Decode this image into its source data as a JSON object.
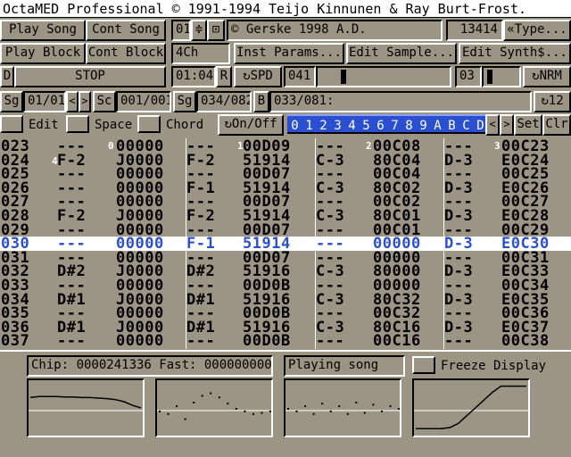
{
  "title": "OctaMED Professional © 1991-1994 Teijo Kinnunen & Ray Burt-Frost.",
  "transport": {
    "play_song": "Play Song",
    "cont_song": "Cont Song",
    "play_block": "Play Block",
    "cont_block": "Cont Block",
    "d": "D",
    "stop": "STOP"
  },
  "song": {
    "num": "01",
    "name": "Gerske 1998 A.D.",
    "memory": "13414",
    "type_button": "«Type...",
    "channels": "4Ch",
    "time": "01:04",
    "r": "R",
    "spd_label": "SPD",
    "spd_value": "041",
    "sample_num": "03",
    "nrm": "NRM"
  },
  "edit_buttons": {
    "inst_params": "Inst Params...",
    "edit_sample": "Edit Sample...",
    "edit_synth": "Edit Synth$..."
  },
  "position": {
    "sg": "Sg",
    "sg_val": "01/01",
    "left": "<",
    "right": ">",
    "sc": "Sc",
    "sc_val": "001/001",
    "sg2": "Sg",
    "sg2_val": "034/082",
    "b": "B",
    "block_val": "033/081:",
    "num12": "12"
  },
  "options": {
    "edit": "Edit",
    "space": "Space",
    "chord": "Chord",
    "on_off": "On/Off",
    "set": "Set",
    "clr": "Clr",
    "left": "<",
    "right": ">"
  },
  "tracks": [
    "0",
    "1",
    "2",
    "3",
    "4",
    "5",
    "6",
    "7",
    "8",
    "9",
    "A",
    "B",
    "C",
    "D"
  ],
  "track_markers": [
    "4",
    "0",
    "1",
    "2",
    "3"
  ],
  "pattern": {
    "current_index": 7,
    "rows": [
      {
        "n": "023",
        "c": [
          [
            "---",
            "00000"
          ],
          [
            "---",
            "00D09"
          ],
          [
            "---",
            "00C08"
          ],
          [
            "---",
            "00C23"
          ]
        ]
      },
      {
        "n": "024",
        "c": [
          [
            "F-2",
            "J0000"
          ],
          [
            "F-2",
            "51914"
          ],
          [
            "C-3",
            "80C04"
          ],
          [
            "D-3",
            "E0C24"
          ]
        ]
      },
      {
        "n": "025",
        "c": [
          [
            "---",
            "00000"
          ],
          [
            "---",
            "00D07"
          ],
          [
            "---",
            "00C04"
          ],
          [
            "---",
            "00C25"
          ]
        ]
      },
      {
        "n": "026",
        "c": [
          [
            "---",
            "00000"
          ],
          [
            "F-1",
            "51914"
          ],
          [
            "C-3",
            "80C02"
          ],
          [
            "D-3",
            "E0C26"
          ]
        ]
      },
      {
        "n": "027",
        "c": [
          [
            "---",
            "00000"
          ],
          [
            "---",
            "00D07"
          ],
          [
            "---",
            "00C02"
          ],
          [
            "---",
            "00C27"
          ]
        ]
      },
      {
        "n": "028",
        "c": [
          [
            "F-2",
            "J0000"
          ],
          [
            "F-2",
            "51914"
          ],
          [
            "C-3",
            "80C01"
          ],
          [
            "D-3",
            "E0C28"
          ]
        ]
      },
      {
        "n": "029",
        "c": [
          [
            "---",
            "00000"
          ],
          [
            "---",
            "00D07"
          ],
          [
            "---",
            "00C01"
          ],
          [
            "---",
            "00C29"
          ]
        ]
      },
      {
        "n": "030",
        "c": [
          [
            "---",
            "00000"
          ],
          [
            "F-1",
            "51914"
          ],
          [
            "---",
            "00000"
          ],
          [
            "D-3",
            "E0C30"
          ]
        ]
      },
      {
        "n": "031",
        "c": [
          [
            "---",
            "00000"
          ],
          [
            "---",
            "00D07"
          ],
          [
            "---",
            "00000"
          ],
          [
            "---",
            "00C31"
          ]
        ]
      },
      {
        "n": "032",
        "c": [
          [
            "D#2",
            "J0000"
          ],
          [
            "D#2",
            "51916"
          ],
          [
            "C-3",
            "80000"
          ],
          [
            "D-3",
            "E0C33"
          ]
        ]
      },
      {
        "n": "033",
        "c": [
          [
            "---",
            "00000"
          ],
          [
            "---",
            "00D0B"
          ],
          [
            "---",
            "00000"
          ],
          [
            "---",
            "00C34"
          ]
        ]
      },
      {
        "n": "034",
        "c": [
          [
            "D#1",
            "J0000"
          ],
          [
            "D#1",
            "51916"
          ],
          [
            "C-3",
            "80C32"
          ],
          [
            "D-3",
            "E0C35"
          ]
        ]
      },
      {
        "n": "035",
        "c": [
          [
            "---",
            "00000"
          ],
          [
            "---",
            "00D0B"
          ],
          [
            "---",
            "00C32"
          ],
          [
            "---",
            "00C36"
          ]
        ]
      },
      {
        "n": "036",
        "c": [
          [
            "D#1",
            "J0000"
          ],
          [
            "D#1",
            "51916"
          ],
          [
            "C-3",
            "80C16"
          ],
          [
            "D-3",
            "E0C37"
          ]
        ]
      },
      {
        "n": "037",
        "c": [
          [
            "---",
            "00000"
          ],
          [
            "---",
            "00D0B"
          ],
          [
            "---",
            "00C16"
          ],
          [
            "---",
            "00C38"
          ]
        ]
      }
    ]
  },
  "status": {
    "memory": "Chip: 0000241336 Fast: 0000000000",
    "state": "Playing song",
    "freeze": "Freeze Display"
  },
  "scopes": [
    {
      "name": "scope-1",
      "values": [
        0.7,
        0.72,
        0.72,
        0.72,
        0.71,
        0.71,
        0.7,
        0.7,
        0.69,
        0.68,
        0.66,
        0.62,
        0.55,
        0.5
      ]
    },
    {
      "name": "scope-2",
      "values": [
        0.45,
        0.4,
        0.55,
        0.3,
        0.62,
        0.75,
        0.8,
        0.72,
        0.6,
        0.5,
        0.45,
        0.4,
        0.42,
        0.45
      ]
    },
    {
      "name": "scope-3",
      "values": [
        0.5,
        0.45,
        0.55,
        0.4,
        0.6,
        0.45,
        0.55,
        0.4,
        0.62,
        0.42,
        0.58,
        0.45,
        0.55,
        0.5
      ]
    },
    {
      "name": "scope-4",
      "values": [
        0.1,
        0.1,
        0.1,
        0.1,
        0.12,
        0.2,
        0.35,
        0.5,
        0.65,
        0.8,
        0.92,
        0.92,
        0.92,
        0.92
      ]
    }
  ],
  "colors": {
    "bg": "#9c9484",
    "accent": "#2a4fd0",
    "highlight": "#ffffff"
  }
}
